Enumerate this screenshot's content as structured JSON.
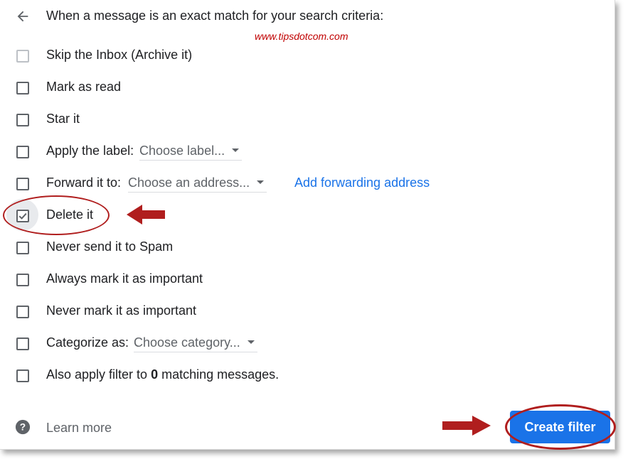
{
  "header": {
    "title": "When a message is an exact match for your search criteria:"
  },
  "watermark": "www.tipsdotcom.com",
  "options": [
    {
      "label": "Skip the Inbox (Archive it)",
      "checked": false
    },
    {
      "label": "Mark as read",
      "checked": false
    },
    {
      "label": "Star it",
      "checked": false
    },
    {
      "label": "Apply the label:",
      "select": "Choose label...",
      "checked": false
    },
    {
      "label": "Forward it to:",
      "select": "Choose an address...",
      "link": "Add forwarding address",
      "checked": false
    },
    {
      "label": "Delete it",
      "checked": true
    },
    {
      "label": "Never send it to Spam",
      "checked": false
    },
    {
      "label": "Always mark it as important",
      "checked": false
    },
    {
      "label": "Never mark it as important",
      "checked": false
    },
    {
      "label": "Categorize as:",
      "select": "Choose category...",
      "checked": false
    },
    {
      "label_prefix": "Also apply filter to ",
      "count": "0",
      "label_suffix": " matching messages.",
      "checked": false
    }
  ],
  "footer": {
    "learn_more": "Learn more",
    "create_filter": "Create filter"
  },
  "colors": {
    "accent": "#1a73e8",
    "annotation": "#b01e1e",
    "watermark": "#c00000"
  },
  "icons": {
    "back": "arrow-left-icon",
    "help": "help-circle-icon",
    "check": "checkmark-icon"
  }
}
